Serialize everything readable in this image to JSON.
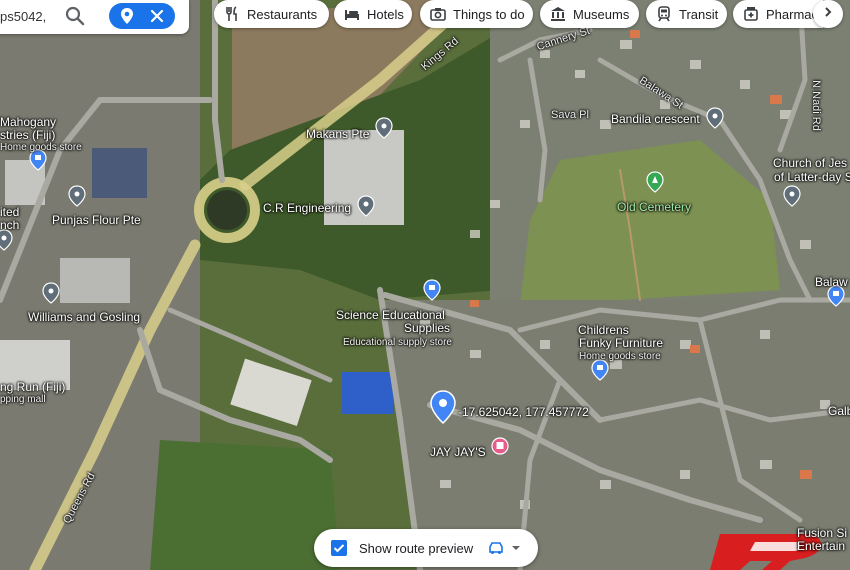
{
  "search": {
    "query_text": "ps5042,"
  },
  "chips": [
    {
      "label": "Restaurants",
      "icon": "fork-knife-icon"
    },
    {
      "label": "Hotels",
      "icon": "bed-icon"
    },
    {
      "label": "Things to do",
      "icon": "camera-icon"
    },
    {
      "label": "Museums",
      "icon": "museum-icon"
    },
    {
      "label": "Transit",
      "icon": "train-icon"
    },
    {
      "label": "Pharmac",
      "icon": "pharmacy-icon"
    }
  ],
  "route_preview": {
    "label": "Show route preview",
    "checked": true
  },
  "colors": {
    "accent_blue": "#1a73e8",
    "pin_gray": "#5f6e78",
    "cemetery_green": "#34a853",
    "shop_blue": "#4285f4",
    "pink": "#e65b8a"
  },
  "places": {
    "mahogany": "Mahogany",
    "mahogany2": "stries (Fiji)",
    "mahogany_sub": "Home goods store",
    "united": "ited",
    "united2": "nch",
    "punjas": "Punjas Flour Pte",
    "williams": "Williams and Gosling",
    "long_run": "ng Run (Fiji)",
    "long_run_sub": "pping mall",
    "makans": "Makans Pte",
    "cr_engineering": "C.R Engineering",
    "science1": "Science Educational",
    "science2": "Supplies",
    "science_sub": "Educational supply store",
    "childrens1": "Childrens",
    "childrens2": "Funky Furniture",
    "childrens_sub": "Home goods store",
    "coordinates": "-17.625042, 177.457772",
    "jay_jays": "JAY JAY'S",
    "bandila": "Bandila crescent",
    "old_cemetery": "Old Cemetery",
    "church1": "Church of Jes",
    "church2": "of Latter-day S",
    "balaw": "Balaw",
    "fusion1": "Fusion Si",
    "fusion2": "Entertain",
    "galb": "Galb"
  },
  "roads": {
    "kings_rd": "Kings Rd",
    "queens_rd": "Queens Rd",
    "cannery_st": "Cannery St",
    "sava_pl": "Sava Pl",
    "balawa_st": "Balawa St",
    "nadi_rd": "N Nadi Rd"
  }
}
